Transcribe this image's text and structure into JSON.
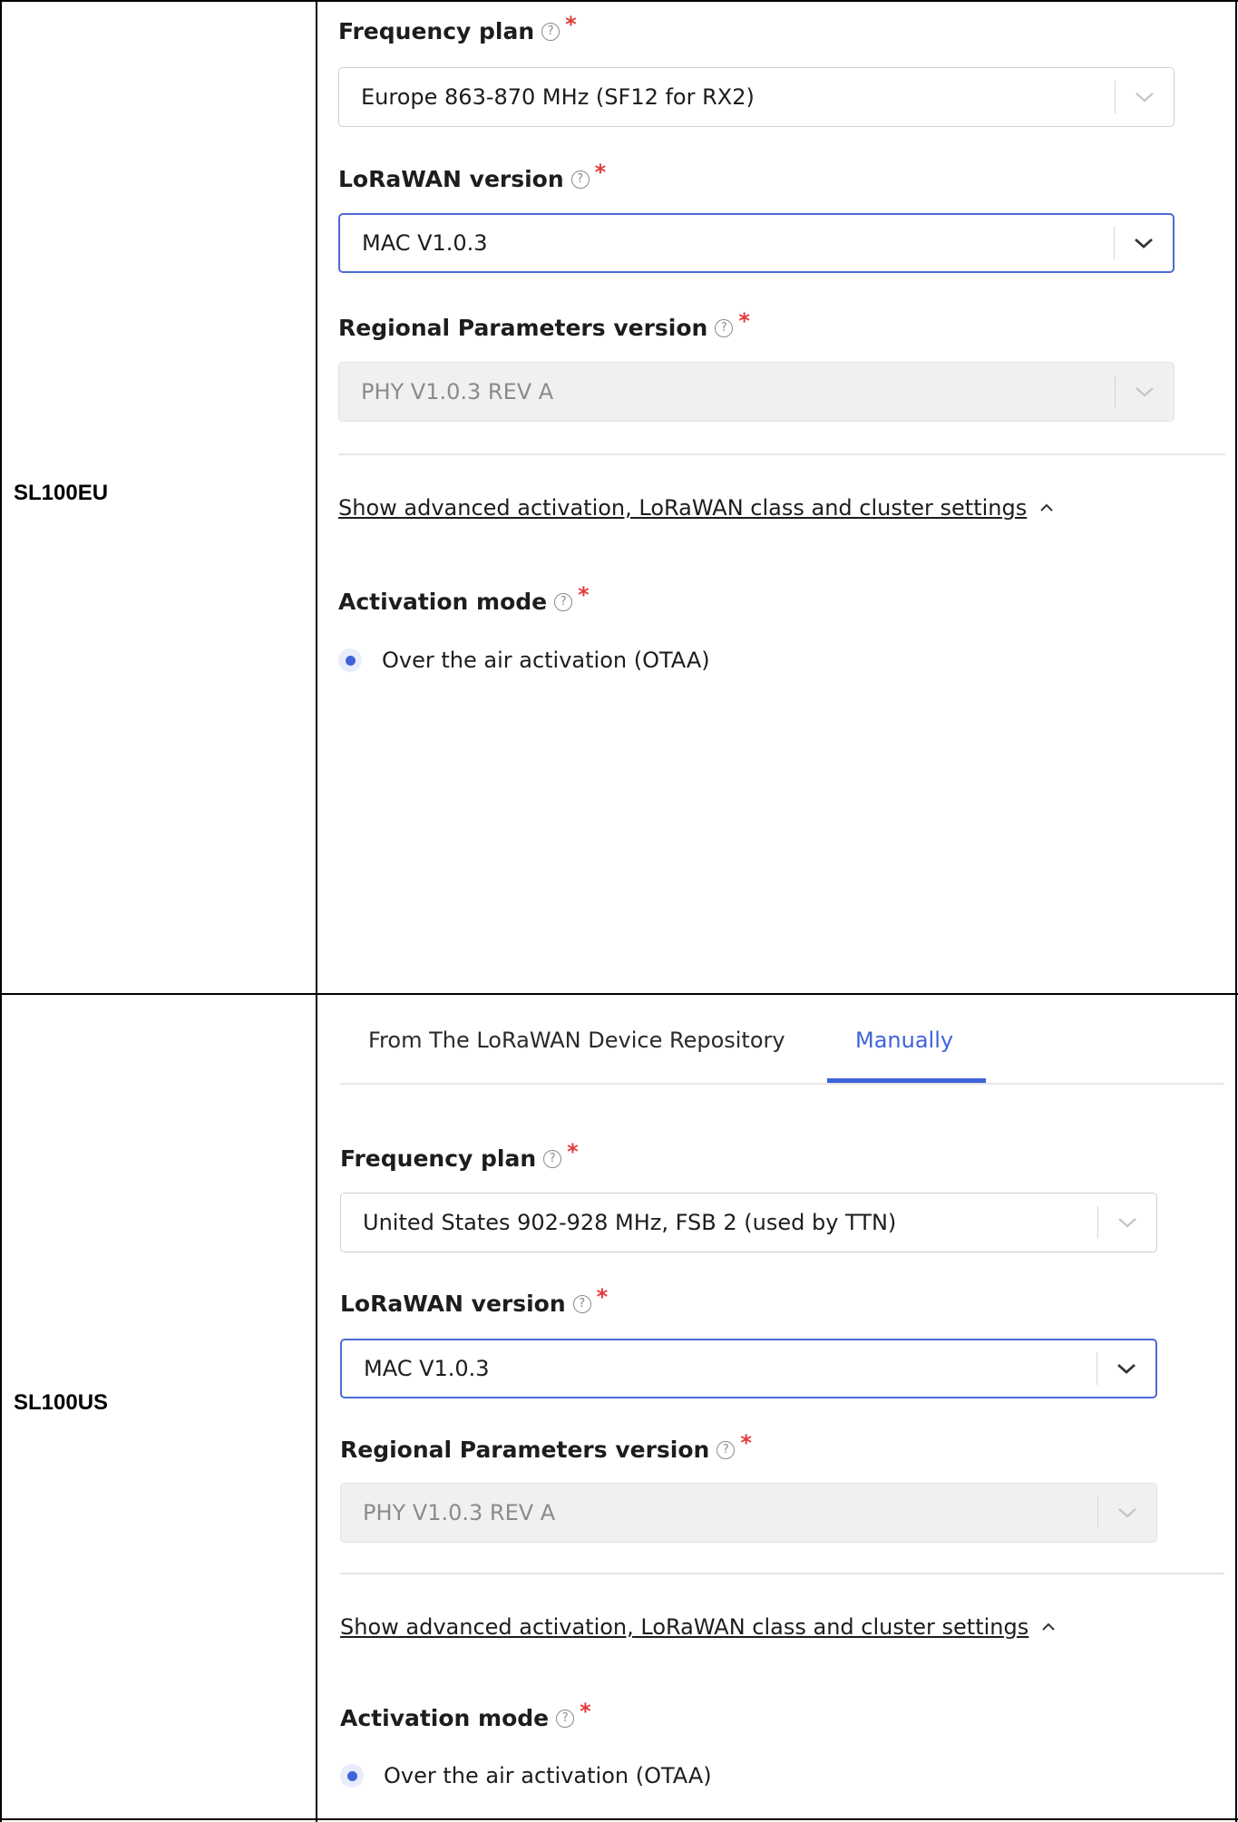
{
  "colors": {
    "accent": "#3f63d8",
    "required": "#e33b3b",
    "border": "#cfcfcf",
    "disabled_bg": "#f0f0f0"
  },
  "rows": [
    {
      "model": "SL100EU",
      "frequency_plan": {
        "label": "Frequency plan",
        "value": "Europe 863-870 MHz (SF12 for RX2)"
      },
      "lorawan_version": {
        "label": "LoRaWAN version",
        "value": "MAC V1.0.3"
      },
      "regional_params": {
        "label": "Regional Parameters version",
        "value": "PHY V1.0.3 REV A"
      },
      "advanced_link": "Show advanced activation, LoRaWAN class and cluster settings",
      "activation_mode": {
        "label": "Activation mode",
        "option": "Over the air activation (OTAA)"
      }
    },
    {
      "model": "SL100US",
      "tabs": [
        {
          "label": "From The LoRaWAN Device Repository",
          "active": false
        },
        {
          "label": "Manually",
          "active": true
        }
      ],
      "frequency_plan": {
        "label": "Frequency plan",
        "value": "United States 902-928 MHz, FSB 2 (used by TTN)"
      },
      "lorawan_version": {
        "label": "LoRaWAN version",
        "value": "MAC V1.0.3"
      },
      "regional_params": {
        "label": "Regional Parameters version",
        "value": "PHY V1.0.3 REV A"
      },
      "advanced_link": "Show advanced activation, LoRaWAN class and cluster settings",
      "activation_mode": {
        "label": "Activation mode",
        "option": "Over the air activation (OTAA)"
      }
    }
  ],
  "icons": {
    "help": "question-circle-icon",
    "required": "asterisk",
    "dropdown": "chevron-down-icon",
    "collapse": "chevron-up-icon"
  }
}
